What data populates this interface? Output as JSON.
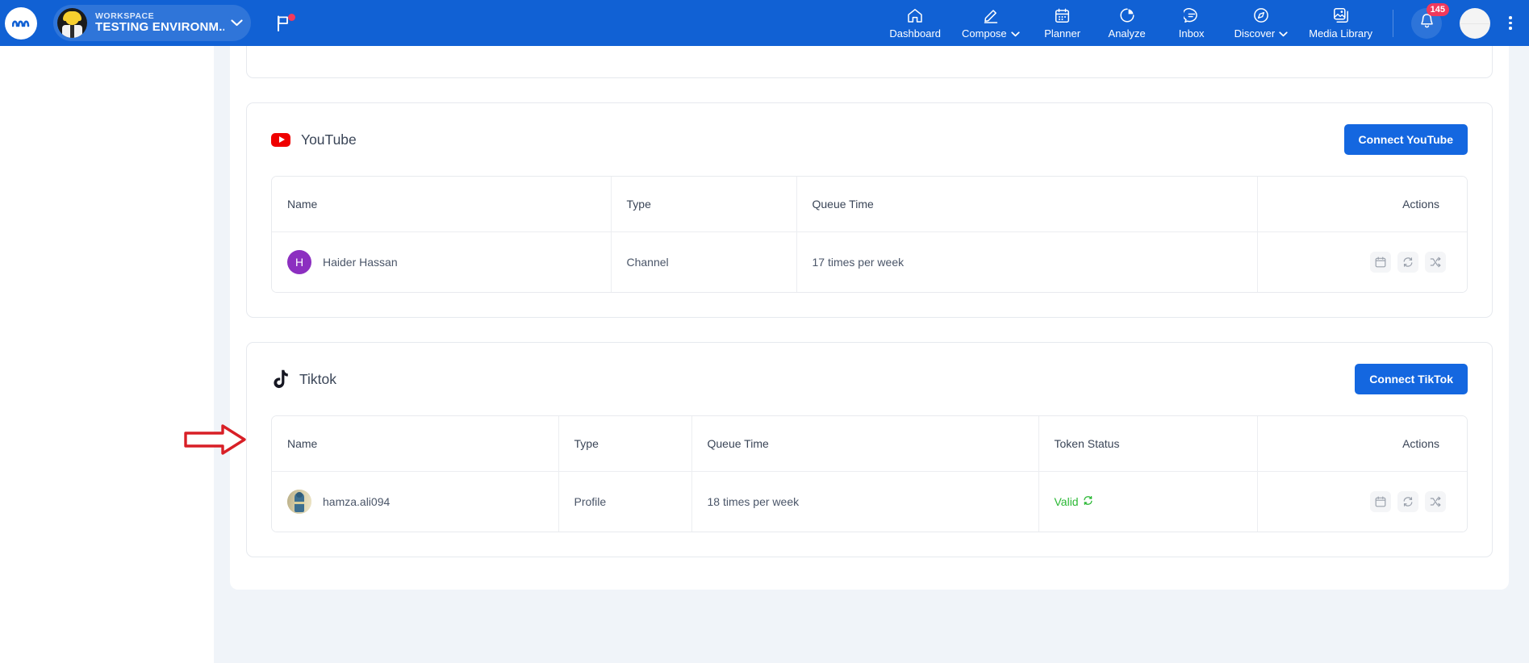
{
  "topnav": {
    "logo_icon": "contentstudio-logo-icon",
    "workspace": {
      "label": "WORKSPACE",
      "name": "TESTING ENVIRONM...",
      "avatar_icon": "workspace-avatar",
      "caret_icon": "chevron-down-icon"
    },
    "flag_icon": "flag-icon",
    "items": [
      {
        "label": "Dashboard",
        "icon": "home-icon",
        "has_caret": false
      },
      {
        "label": "Compose",
        "icon": "pencil-icon",
        "has_caret": true
      },
      {
        "label": "Planner",
        "icon": "calendar-icon",
        "has_caret": false
      },
      {
        "label": "Analyze",
        "icon": "pie-chart-icon",
        "has_caret": false
      },
      {
        "label": "Inbox",
        "icon": "chat-bubble-icon",
        "has_caret": false
      },
      {
        "label": "Discover",
        "icon": "compass-icon",
        "has_caret": true
      },
      {
        "label": "Media Library",
        "icon": "images-icon",
        "has_caret": false
      }
    ],
    "notifications": {
      "icon": "bell-icon",
      "count": "145"
    },
    "avatar_icon": "user-avatar",
    "kebab_icon": "kebab-menu-icon"
  },
  "annotation": {
    "arrow_icon": "red-right-arrow-annotation",
    "color": "#d81f26"
  },
  "sections": [
    {
      "id": "youtube",
      "platform": "YouTube",
      "platform_icon": "youtube-icon",
      "connect_label": "Connect YouTube",
      "columns": [
        "Name",
        "Type",
        "Queue Time",
        "Actions"
      ],
      "rows": [
        {
          "avatar_kind": "letter",
          "avatar_letter": "H",
          "name": "Haider Hassan",
          "type": "Channel",
          "queue_time": "17 times per week",
          "actions": [
            "calendar-icon",
            "refresh-icon",
            "shuffle-icon"
          ]
        }
      ]
    },
    {
      "id": "tiktok",
      "platform": "Tiktok",
      "platform_icon": "tiktok-icon",
      "connect_label": "Connect TikTok",
      "columns": [
        "Name",
        "Type",
        "Queue Time",
        "Token Status",
        "Actions"
      ],
      "rows": [
        {
          "avatar_kind": "photo",
          "avatar_letter": "",
          "name": "hamza.ali094",
          "type": "Profile",
          "queue_time": "18 times per week",
          "token_status": "Valid",
          "token_status_color": "#2ab834",
          "token_refresh_icon": "refresh-icon",
          "actions": [
            "calendar-icon",
            "refresh-icon",
            "shuffle-icon"
          ]
        }
      ]
    }
  ]
}
